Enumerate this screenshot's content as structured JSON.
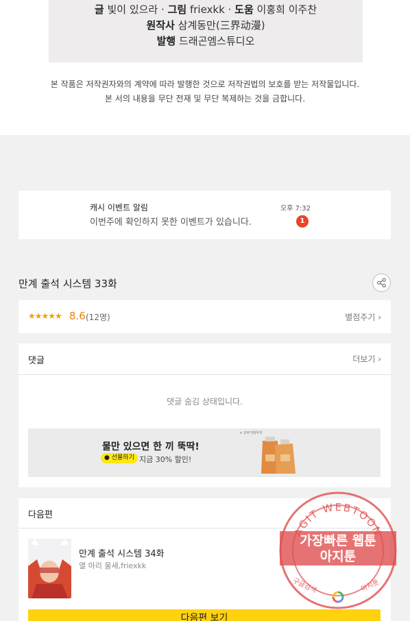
{
  "credits": {
    "writer_label": "글",
    "writer": "빛이 있으라",
    "art_label": "그림",
    "art": "friexkk",
    "assist_label": "도움",
    "assist": "이홍희 이주찬",
    "original_label": "원작사",
    "original": "삼계동만(三界动漫)",
    "publisher_label": "발행",
    "publisher": "드래곤엠스튜디오",
    "sep": "·"
  },
  "copyright": {
    "line1": "본 작품은 저작권자와의 계약에 따라 발행한 것으로 저작권법의 보호를 받는 저작물입니다.",
    "line2": "본 서의 내용을 무단 전재 및 무단 복제하는 것을 금합니다."
  },
  "notification": {
    "title": "캐시 이벤트 알림",
    "message": "이번주에 확인하지 못한 이벤트가 있습니다.",
    "time": "오후 7:32",
    "badge": "1"
  },
  "episode": {
    "title": "만계 출석 시스템 33화",
    "share_icon": "share-icon"
  },
  "rating": {
    "stars": "★★★★★",
    "score": "8.6",
    "score_value": 8.6,
    "votes": "(12명)",
    "rate_link": "별점주기",
    "chevron": "›",
    "accent_color": "#e8820c"
  },
  "comments": {
    "label": "댓글",
    "more": "더보기",
    "hidden_message": "댓글 숨김 상태입니다."
  },
  "ad": {
    "title": "물만 있으면 한 끼 뚝딱!",
    "pill": "선물하기",
    "discount": "지금 30% 할인!",
    "brand": "☀ 오뚜기파우치"
  },
  "next_episode": {
    "label": "다음편",
    "title": "만계 출석 시스템 34화",
    "authors": "열 마리 울새,friexkk",
    "button": "다음편 보기",
    "button_color": "#ffd210"
  },
  "watermark": {
    "ring_text": "AGIT WEBTOON",
    "line1": "가장빠른 웹툰",
    "line2": "아지툰",
    "search": "구글검색",
    "name": "아지툰",
    "color": "#e05050"
  }
}
